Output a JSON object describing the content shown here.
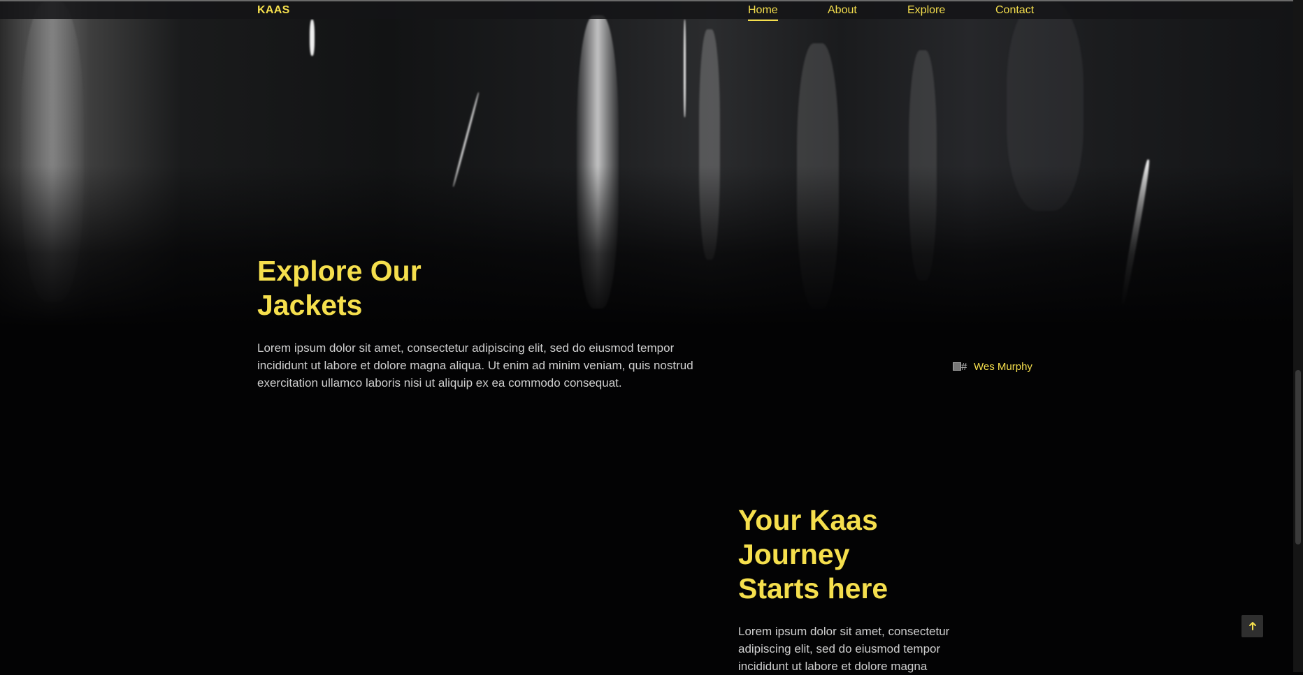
{
  "brand": {
    "name": "KAAS"
  },
  "nav": {
    "items": [
      {
        "label": "Home",
        "active": true
      },
      {
        "label": "About",
        "active": false
      },
      {
        "label": "Explore",
        "active": false
      },
      {
        "label": "Contact",
        "active": false
      }
    ]
  },
  "hero": {
    "title_line1": "Explore Our",
    "title_line2": "Jackets",
    "body": "Lorem ipsum dolor sit amet, consectetur adipiscing elit, sed do eiusmod tempor incididunt ut labore et dolore magna aliqua. Ut enim ad minim veniam, quis nostrud exercitation ullamco laboris nisi ut aliquip ex ea commodo consequat."
  },
  "author": {
    "avatar_alt": "#",
    "name": "Wes Murphy"
  },
  "journey": {
    "title_line1": "Your Kaas",
    "title_line2": "Journey",
    "title_line3": "Starts here",
    "body": "Lorem ipsum dolor sit amet, consectetur adipiscing elit, sed do eiusmod tempor incididunt ut labore et dolore magna"
  },
  "colors": {
    "accent": "#f5df4d",
    "background": "#030304",
    "body_text": "#cfcfcf"
  },
  "icons": {
    "back_to_top": "arrow-up-icon",
    "avatar": "broken-image-icon"
  }
}
